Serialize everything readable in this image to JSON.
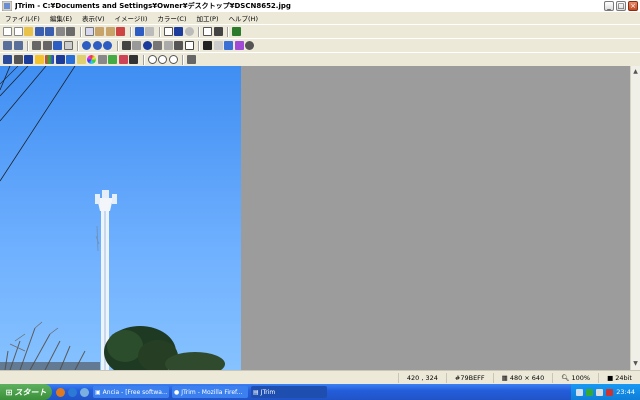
{
  "window": {
    "title": "JTrim - C:¥Documents and Settings¥Owner¥デスクトップ¥DSCN8652.jpg"
  },
  "menu": [
    "ファイル(F)",
    "編集(E)",
    "表示(V)",
    "イメージ(I)",
    "カラー(C)",
    "加工(P)",
    "ヘルプ(H)"
  ],
  "status": {
    "coords": "420 , 324",
    "color_hex": "#79BEFF",
    "image_size": "480 × 640",
    "zoom": "100%",
    "depth": "24bit"
  },
  "taskbar": {
    "start_label": "スタート",
    "tasks": [
      "Ancia - [Free softwa...",
      "JTrim - Mozilla Firef...",
      "JTrim"
    ],
    "clock": "23:44"
  },
  "colors": {
    "sky": "#79BEFF",
    "workspace": "#9C9C9C",
    "taskbar": "#245EDB"
  }
}
